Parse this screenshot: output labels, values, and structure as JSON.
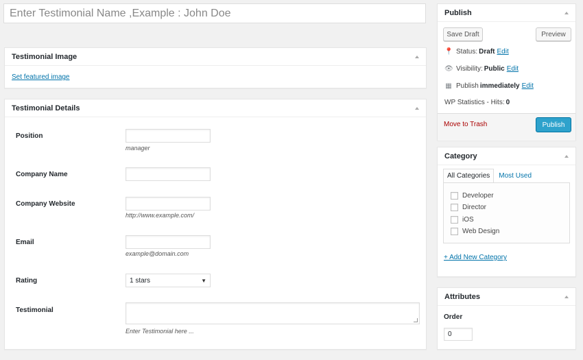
{
  "title_field": {
    "placeholder": "Enter Testimonial Name ,Example : John Doe"
  },
  "image_box": {
    "title": "Testimonial Image",
    "link": "Set featured image"
  },
  "details_box": {
    "title": "Testimonial Details",
    "fields": [
      {
        "label": "Position",
        "hint": "manager"
      },
      {
        "label": "Company Name",
        "hint": ""
      },
      {
        "label": "Company Website",
        "hint": "http://www.example.com/"
      },
      {
        "label": "Email",
        "hint": "example@domain.com"
      },
      {
        "label": "Rating",
        "value": "1 stars"
      },
      {
        "label": "Testimonial",
        "hint": "Enter Testimonial here ..."
      }
    ]
  },
  "publish_box": {
    "title": "Publish",
    "save_draft": "Save Draft",
    "preview": "Preview",
    "status_label": "Status:",
    "status_value": "Draft",
    "visibility_label": "Visibility:",
    "visibility_value": "Public",
    "publish_label": "Publish",
    "publish_value": "immediately",
    "edit": "Edit",
    "stats": "WP Statistics - Hits:",
    "stats_value": "0",
    "trash": "Move to Trash",
    "publish_button": "Publish"
  },
  "category_box": {
    "title": "Category",
    "tabs": [
      "All Categories",
      "Most Used"
    ],
    "items": [
      "Developer",
      "Director",
      "iOS",
      "Web Design"
    ],
    "add_link": "+ Add New Category"
  },
  "attributes_box": {
    "title": "Attributes",
    "order_label": "Order",
    "order_value": "0"
  },
  "colors": {
    "accent": "#0073aa",
    "primary_button": "#2ea2cc",
    "trash": "#a00"
  }
}
